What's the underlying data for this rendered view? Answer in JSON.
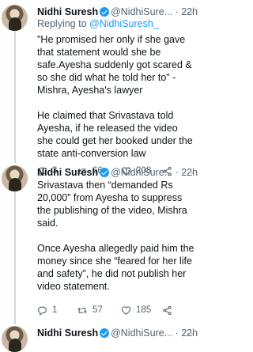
{
  "tweets": [
    {
      "name": "Nidhi Suresh",
      "handle": "@NidhiSure...",
      "dot": "·",
      "time": "22h",
      "reply_prefix": "Replying to ",
      "reply_to": "@NidhiSuresh_",
      "paragraphs": [
        "\"He promised her only if she gave that statement would she be safe.Ayesha suddenly got scared & so she did what he told her to\" - Mishra, Ayesha's lawyer",
        "He claimed that Srivastava told Ayesha, if he released the video she could get her booked under the state anti-conversion law"
      ],
      "replies": "3",
      "retweets": "66",
      "likes": "208"
    },
    {
      "name": "Nidhi Suresh",
      "handle": "@NidhiSure...",
      "dot": "·",
      "time": "22h",
      "paragraphs": [
        "Srivastava then “demanded Rs 20,000” from Ayesha to suppress the publishing of the video, Mishra said.",
        "Once Ayesha allegedly paid him the money since she “feared for her life and safety”, he did not publish her video statement."
      ],
      "replies": "1",
      "retweets": "57",
      "likes": "185"
    },
    {
      "name": "Nidhi Suresh",
      "handle": "@NidhiSure...",
      "dot": "·",
      "time": "22h"
    }
  ],
  "icons": {
    "verified": "verified-badge-icon",
    "reply": "reply-icon",
    "retweet": "retweet-icon",
    "like": "heart-icon",
    "share": "share-icon",
    "more": "more-icon"
  },
  "colors": {
    "accent": "#1d9bf0",
    "secondary_text": "#536471",
    "text": "#0f1419",
    "thread_line": "#cfd9de"
  }
}
